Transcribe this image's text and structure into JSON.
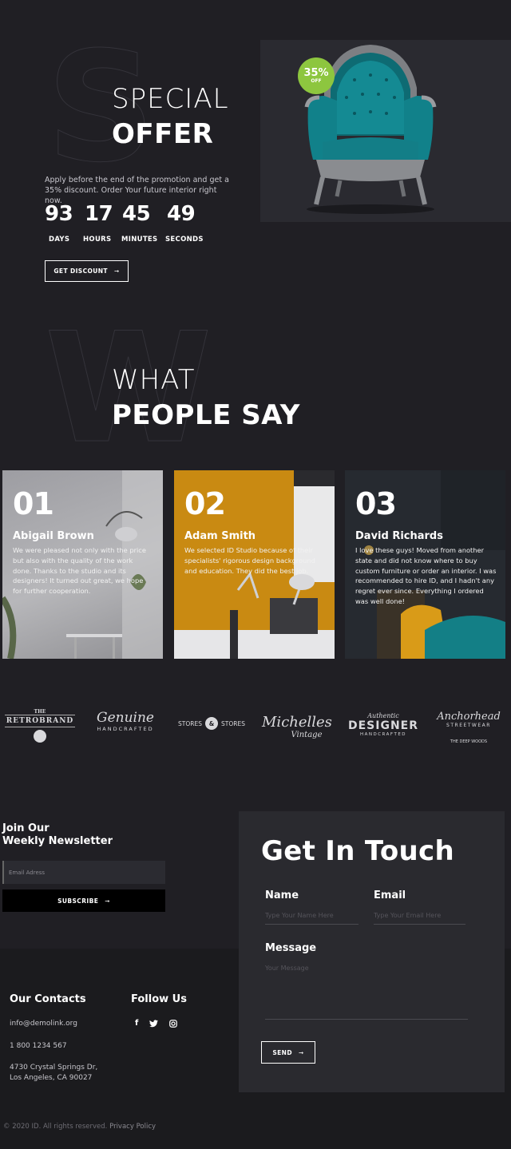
{
  "offer": {
    "bg_letter": "S",
    "title_thin": "SPECIAL",
    "title_bold": "OFFER",
    "description": "Apply before the end of the promotion and get a 35% discount. Order Your future interior right now.",
    "countdown": [
      {
        "value": "93",
        "label": "DAYS"
      },
      {
        "value": "17",
        "label": "HOURS"
      },
      {
        "value": "45",
        "label": "MINUTES"
      },
      {
        "value": "49",
        "label": "SECONDS"
      }
    ],
    "button_label": "GET DISCOUNT",
    "badge_value": "35%",
    "badge_label": "OFF",
    "badge_color": "#8dc63f"
  },
  "testimonials": {
    "bg_letter": "W",
    "title_thin": "WHAT",
    "title_bold": "PEOPLE SAY",
    "items": [
      {
        "num": "01",
        "name": "Abigail Brown",
        "text": "We were pleased not only with the price but also with the quality of the work done. Thanks to the studio and its designers! It turned out great, we hope for further cooperation."
      },
      {
        "num": "02",
        "name": "Adam Smith",
        "text": "We selected ID Studio because of their specialists' rigorous design background and education. They did the best job."
      },
      {
        "num": "03",
        "name": "David Richards",
        "text": "I love these guys! Moved from another state and did not know where to buy custom furniture or order an interior. I was recommended to hire ID, and I hadn't any regret ever since. Everything I ordered was well done!"
      }
    ]
  },
  "logos": {
    "retrobrand": {
      "top": "THE",
      "main": "RETROBRAND"
    },
    "genuine": {
      "main": "Genuine",
      "sub": "HANDCRAFTED"
    },
    "stores": {
      "left": "STORES",
      "mid": "&",
      "right": "STORES"
    },
    "michelles": {
      "main": "Michelles",
      "sub": "Vintage"
    },
    "designer": {
      "top": "Authentic",
      "main": "DESIGNER",
      "sub": "HANDCRAFTED"
    },
    "anchorhead": {
      "main": "Anchorhead",
      "sub": "STREETWEAR",
      "bottom": "THE DEEP WOODS"
    }
  },
  "newsletter": {
    "title_line1": "Join Our",
    "title_line2": "Weekly Newsletter",
    "email_placeholder": "Email Adress",
    "button_label": "SUBSCRIBE"
  },
  "contact": {
    "title": "Get In Touch",
    "name_label": "Name",
    "name_placeholder": "Type Your Name Here",
    "email_label": "Email",
    "email_placeholder": "Type Your Email Here",
    "message_label": "Message",
    "message_placeholder": "Your Message",
    "send_label": "SEND"
  },
  "footer": {
    "contacts_title": "Our Contacts",
    "email": "info@demolink.org",
    "phone": "1 800 1234 567",
    "address_line1": "4730 Crystal Springs Dr,",
    "address_line2": "Los Angeles, CA 90027",
    "follow_title": "Follow Us",
    "social": {
      "facebook": "f",
      "twitter": "twitter-icon",
      "instagram": "instagram-icon"
    },
    "copyright": "© 2020 ID. All rights reserved.",
    "privacy": "Privacy Policy"
  }
}
